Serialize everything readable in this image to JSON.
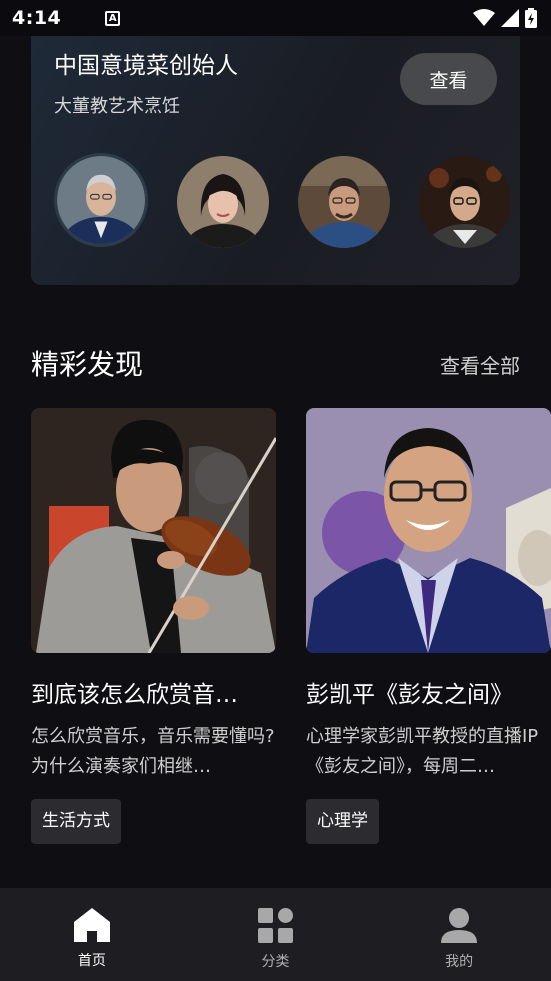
{
  "status_bar": {
    "time": "4:14",
    "badge": "A"
  },
  "feature": {
    "title": "中国意境菜创始人",
    "subtitle": "大董教艺术烹饪",
    "view_button": "查看",
    "avatars": [
      "avatar-1",
      "avatar-2",
      "avatar-3",
      "avatar-4"
    ]
  },
  "section": {
    "title": "精彩发现",
    "view_all": "查看全部"
  },
  "cards": [
    {
      "title": "到底该怎么欣赏音…",
      "description": "怎么欣赏音乐，音乐需要懂吗? 为什么演奏家们相继…",
      "tag": "生活方式"
    },
    {
      "title": "彭凯平《彭友之间》",
      "description": "心理学家彭凯平教授的直播IP《彭友之间》，每周二…",
      "tag": "心理学"
    }
  ],
  "nav": [
    {
      "label": "首页",
      "icon": "home-icon",
      "active": true
    },
    {
      "label": "分类",
      "icon": "grid-icon",
      "active": false
    },
    {
      "label": "我的",
      "icon": "person-icon",
      "active": false
    }
  ],
  "colors": {
    "background": "#0f0e13",
    "nav_background": "#1e1e22",
    "tag_background": "#2b2b30"
  }
}
